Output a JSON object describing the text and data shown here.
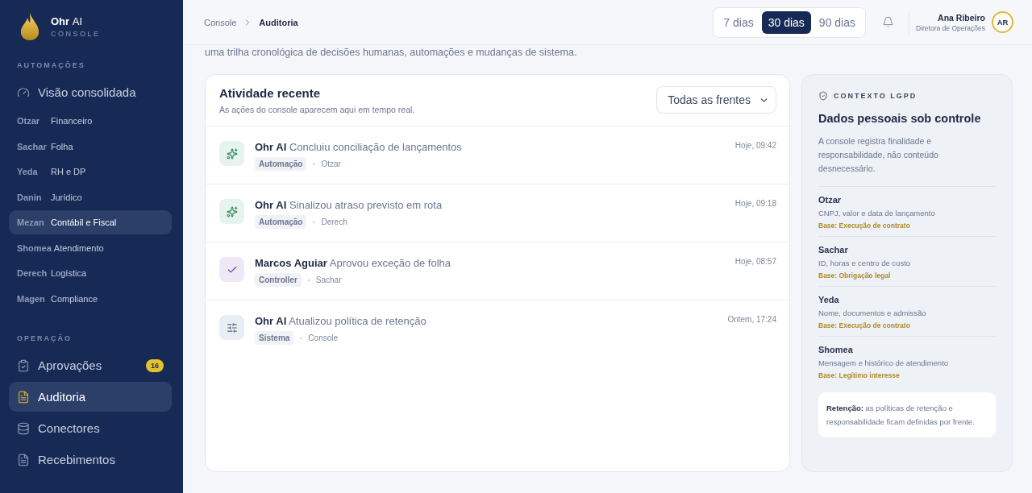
{
  "brand": {
    "name_bold": "Ohr",
    "name_light": "AI",
    "subtitle": "CONSOLE"
  },
  "sidebar": {
    "sections": [
      {
        "title": "AUTOMAÇÕES",
        "items": [
          {
            "kind": "main",
            "label": "Visão consolidada",
            "selected": false
          },
          {
            "kind": "module",
            "code": "Otzar",
            "label": "Financeiro",
            "selected": false
          },
          {
            "kind": "module",
            "code": "Sachar",
            "label": "Folha",
            "selected": false
          },
          {
            "kind": "module",
            "code": "Yeda",
            "label": "RH e DP",
            "selected": false
          },
          {
            "kind": "module",
            "code": "Danin",
            "label": "Jurídico",
            "selected": false
          },
          {
            "kind": "module",
            "code": "Mezan",
            "label": "Contábil e Fiscal",
            "selected": true
          },
          {
            "kind": "module",
            "code": "Shomea",
            "label": "Atendimento",
            "selected": false
          },
          {
            "kind": "module",
            "code": "Derech",
            "label": "Logística",
            "selected": false
          },
          {
            "kind": "module",
            "code": "Magen",
            "label": "Compliance",
            "selected": false
          }
        ]
      },
      {
        "title": "OPERAÇÃO",
        "items": [
          {
            "kind": "main",
            "label": "Aprovações",
            "badge": "16",
            "selected": false
          },
          {
            "kind": "main",
            "label": "Auditoria",
            "selected": true
          },
          {
            "kind": "main",
            "label": "Conectores",
            "selected": false
          },
          {
            "kind": "main",
            "label": "Recebimentos",
            "selected": false
          }
        ]
      }
    ]
  },
  "breadcrumb": [
    "Console",
    "Auditoria"
  ],
  "ranges": [
    {
      "label": "7 dias",
      "selected": false
    },
    {
      "label": "30 dias",
      "selected": true
    },
    {
      "label": "90 dias",
      "selected": false
    }
  ],
  "user": {
    "name": "Ana Ribeiro",
    "role": "Diretora de Operações",
    "initials": "AR"
  },
  "page_subtitle": "uma trilha cronológica de decisões humanas, automações e mudanças de sistema.",
  "activity": {
    "title": "Atividade recente",
    "subtitle": "As ações do console aparecem aqui em tempo real.",
    "filter": "Todas as frentes",
    "items": [
      {
        "kind": "automation",
        "actor": "Ohr AI",
        "action": "Concluiu conciliação de lançamentos",
        "tag": "Automação",
        "source": "Otzar",
        "time": "Hoje, 09:42"
      },
      {
        "kind": "automation",
        "actor": "Ohr AI",
        "action": "Sinalizou atraso previsto em rota",
        "tag": "Automação",
        "source": "Derech",
        "time": "Hoje, 09:18"
      },
      {
        "kind": "approval",
        "actor": "Marcos Aguiar",
        "action": "Aprovou exceção de folha",
        "tag": "Controller",
        "source": "Sachar",
        "time": "Hoje, 08:57"
      },
      {
        "kind": "system",
        "actor": "Ohr AI",
        "action": "Atualizou política de retenção",
        "tag": "Sistema",
        "source": "Console",
        "time": "Ontem, 17:24"
      }
    ]
  },
  "lgpd": {
    "eyebrow": "CONTEXTO LGPD",
    "title": "Dados pessoais sob controle",
    "description": "A console registra finalidade e responsabilidade, não conteúdo desnecessário.",
    "entries": [
      {
        "name": "Otzar",
        "data": "CNPJ, valor e data de lançamento",
        "basis": "Base: Execução de contrato"
      },
      {
        "name": "Sachar",
        "data": "ID, horas e centro de custo",
        "basis": "Base: Obrigação legal"
      },
      {
        "name": "Yeda",
        "data": "Nome, documentos e admissão",
        "basis": "Base: Execução de contrato"
      },
      {
        "name": "Shomea",
        "data": "Mensagem e histórico de atendimento",
        "basis": "Base: Legítimo interesse"
      }
    ],
    "note": "**Retenção:** as políticas de retenção e responsabilidade ficam definidas por frente."
  }
}
